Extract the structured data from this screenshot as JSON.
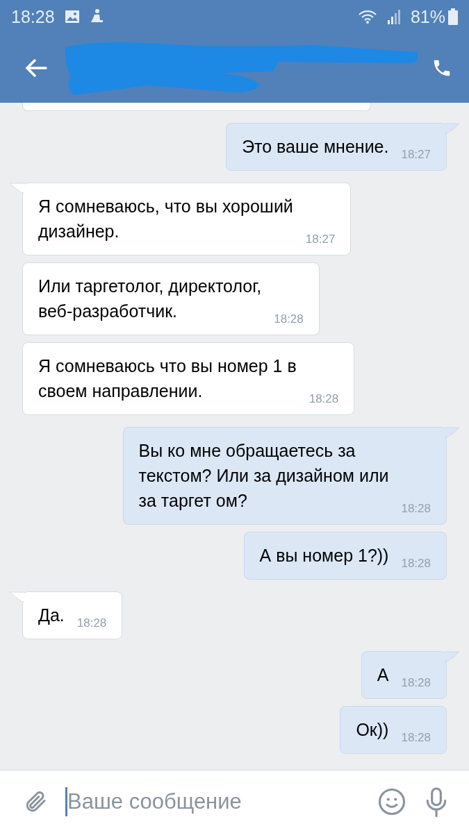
{
  "status_bar": {
    "time": "18:28",
    "battery": "81%"
  },
  "header": {
    "redacted": true
  },
  "messages": [
    {
      "kind": "cut",
      "outgoing": false
    },
    {
      "kind": "message",
      "outgoing": true,
      "tail": true,
      "text": "Это ваше мнение.",
      "time": "18:27"
    },
    {
      "kind": "message",
      "outgoing": false,
      "tail": true,
      "text": "Я сомневаюсь, что вы хороший\nдизайнер.",
      "time": "18:27"
    },
    {
      "kind": "message",
      "outgoing": false,
      "tail": false,
      "text": "Или таргетолог, директолог,\nвеб-разработчик.",
      "time": "18:28"
    },
    {
      "kind": "message",
      "outgoing": false,
      "tail": false,
      "text": "Я сомневаюсь что вы номер 1 в\nсвоем направлении.",
      "time": "18:28"
    },
    {
      "kind": "message",
      "outgoing": true,
      "tail": true,
      "text": "Вы ко мне обращаетесь за\nтекстом? Или за дизайном или\nза таргет ом?",
      "time": "18:28"
    },
    {
      "kind": "message",
      "outgoing": true,
      "tail": false,
      "text": "А вы номер 1?))",
      "time": "18:28"
    },
    {
      "kind": "message",
      "outgoing": false,
      "tail": true,
      "text": "Да.",
      "time": "18:28"
    },
    {
      "kind": "message",
      "outgoing": true,
      "tail": true,
      "text": "А",
      "time": "18:28"
    },
    {
      "kind": "message",
      "outgoing": true,
      "tail": false,
      "text": "Ок))",
      "time": "18:28"
    }
  ],
  "composer": {
    "placeholder": "Ваше сообщение"
  }
}
